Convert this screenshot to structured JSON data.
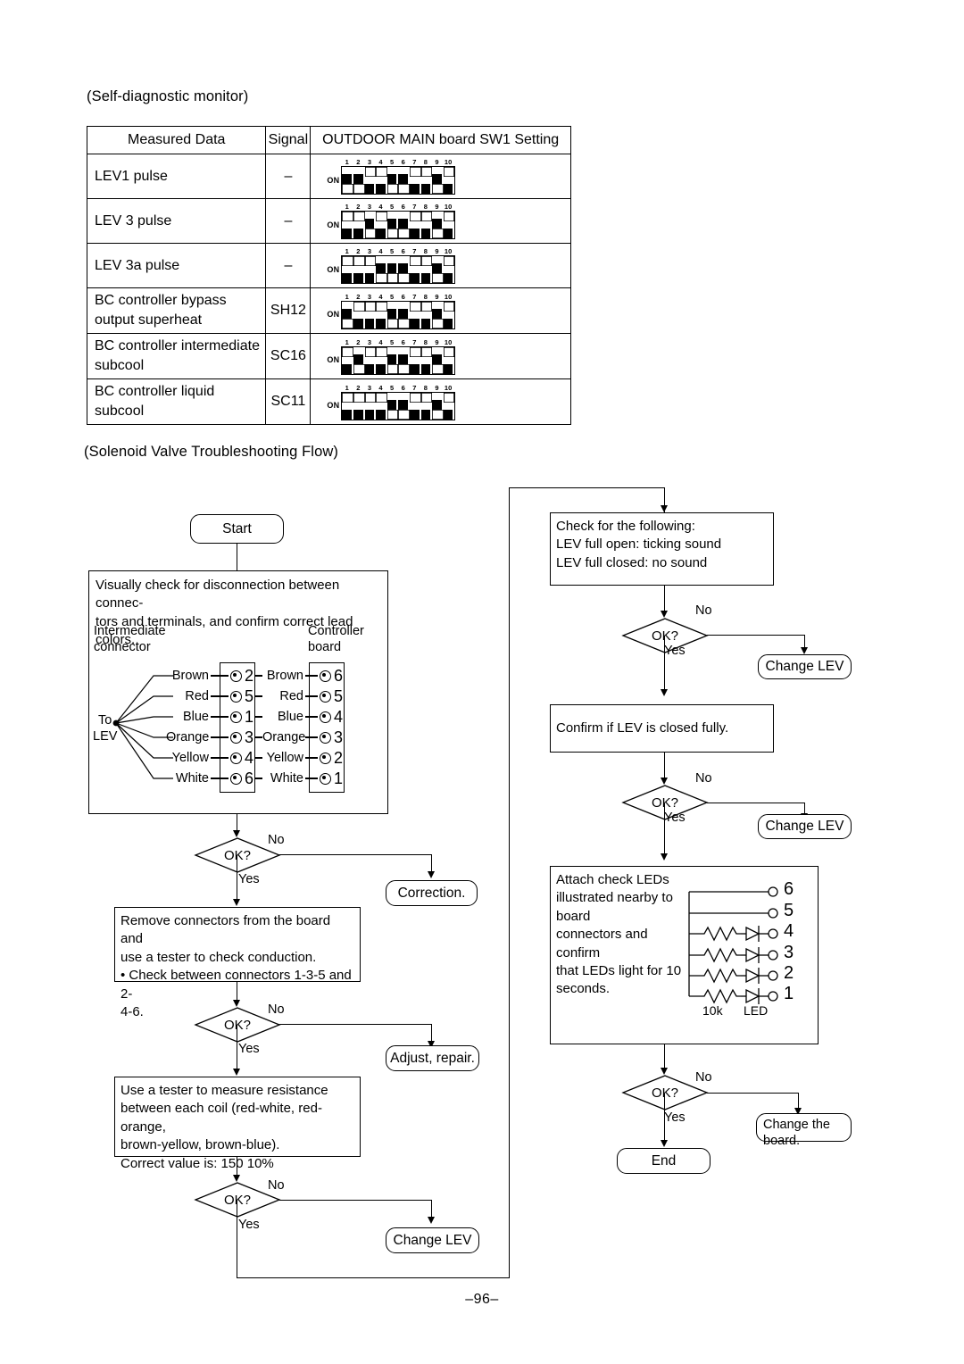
{
  "page": {
    "number": "–96–"
  },
  "sections": {
    "self_diagnostic_caption": "(Self-diagnostic monitor)",
    "solenoid_caption": "(Solenoid Valve Troubleshooting Flow)"
  },
  "table": {
    "headers": [
      "Measured Data",
      "Signal",
      "OUTDOOR MAIN board SW1 Setting"
    ],
    "switch_labels": [
      "1",
      "2",
      "3",
      "4",
      "5",
      "6",
      "7",
      "8",
      "9",
      "10"
    ],
    "on_label": "ON",
    "rows": [
      {
        "measured_data": "LEV1 pulse",
        "signal": "–",
        "switch_top": [
          1,
          1,
          0,
          0,
          1,
          1,
          0,
          0,
          1,
          0
        ],
        "switch_bottom": [
          0,
          0,
          1,
          1,
          0,
          0,
          1,
          1,
          0,
          1
        ]
      },
      {
        "measured_data": "LEV 3 pulse",
        "signal": "–",
        "switch_top": [
          0,
          0,
          1,
          0,
          1,
          1,
          0,
          0,
          1,
          0
        ],
        "switch_bottom": [
          1,
          1,
          0,
          1,
          0,
          0,
          1,
          1,
          0,
          1
        ]
      },
      {
        "measured_data": "LEV 3a pulse",
        "signal": "–",
        "switch_top": [
          0,
          0,
          0,
          1,
          1,
          1,
          0,
          0,
          1,
          0
        ],
        "switch_bottom": [
          1,
          1,
          1,
          0,
          0,
          0,
          1,
          1,
          0,
          1
        ]
      },
      {
        "measured_data": "BC controller bypass output superheat",
        "signal": "SH12",
        "switch_top": [
          1,
          0,
          0,
          0,
          1,
          1,
          0,
          0,
          1,
          0
        ],
        "switch_bottom": [
          0,
          1,
          1,
          1,
          0,
          0,
          1,
          1,
          0,
          1
        ]
      },
      {
        "measured_data": "BC controller intermediate subcool",
        "signal": "SC16",
        "switch_top": [
          0,
          1,
          0,
          0,
          1,
          1,
          0,
          0,
          1,
          0
        ],
        "switch_bottom": [
          1,
          0,
          1,
          1,
          0,
          0,
          1,
          1,
          0,
          1
        ]
      },
      {
        "measured_data": "BC controller liquid subcool",
        "signal": "SC11",
        "switch_top": [
          0,
          0,
          0,
          0,
          1,
          1,
          0,
          0,
          1,
          0
        ],
        "switch_bottom": [
          1,
          1,
          1,
          1,
          0,
          0,
          1,
          1,
          0,
          1
        ]
      }
    ]
  },
  "flow": {
    "labels": {
      "yes": "Yes",
      "no": "No",
      "ok": "OK?"
    },
    "left": {
      "start": "Start",
      "visual_check": "Visually check for disconnection between connec-\ntors and terminals, and confirm correct lead colors.",
      "correction": "Correction.",
      "remove_connectors": "Remove connectors from the board and\nuse a tester to check conduction.\n•  Check between connectors 1-3-5 and 2-\n   4-6.",
      "adjust_repair": "Adjust, repair.",
      "measure_resistance": "Use a tester to measure resistance\nbetween each coil (red-white, red-orange,\nbrown-yellow, brown-blue).\nCorrect value is: 150    10%",
      "change_lev": "Change LEV"
    },
    "right": {
      "check_following": "Check for the following:\nLEV full open: ticking sound\nLEV full closed: no sound",
      "change_lev_1": "Change LEV",
      "confirm_closed": "Confirm if LEV is closed fully.",
      "change_lev_2": "Change LEV",
      "attach_leds": "Attach check LEDs\nillustrated nearby to board\nconnectors and confirm\nthat LEDs light for 10\nseconds.",
      "change_board": "Change the\nboard.",
      "end": "End"
    }
  },
  "wiring": {
    "to_lev": "To\nLEV",
    "intermediate_connector": "Intermediate\nconnector",
    "controller_board": "Controller\nboard",
    "intermediate_pins": [
      {
        "color": "Brown",
        "pin": "2"
      },
      {
        "color": "Red",
        "pin": "5"
      },
      {
        "color": "Blue",
        "pin": "1"
      },
      {
        "color": "Orange",
        "pin": "3"
      },
      {
        "color": "Yellow",
        "pin": "4"
      },
      {
        "color": "White",
        "pin": "6"
      }
    ],
    "controller_pins": [
      {
        "color": "Brown",
        "pin": "6"
      },
      {
        "color": "Red",
        "pin": "5"
      },
      {
        "color": "Blue",
        "pin": "4"
      },
      {
        "color": "Orange",
        "pin": "3"
      },
      {
        "color": "Yellow",
        "pin": "2"
      },
      {
        "color": "White",
        "pin": "1"
      }
    ]
  },
  "led_circuit": {
    "resistor_label": "10k",
    "led_label": "LED",
    "terminals": [
      {
        "num": "6",
        "has_components": false
      },
      {
        "num": "5",
        "has_components": false
      },
      {
        "num": "4",
        "has_components": true
      },
      {
        "num": "3",
        "has_components": true
      },
      {
        "num": "2",
        "has_components": true
      },
      {
        "num": "1",
        "has_components": true
      }
    ]
  }
}
